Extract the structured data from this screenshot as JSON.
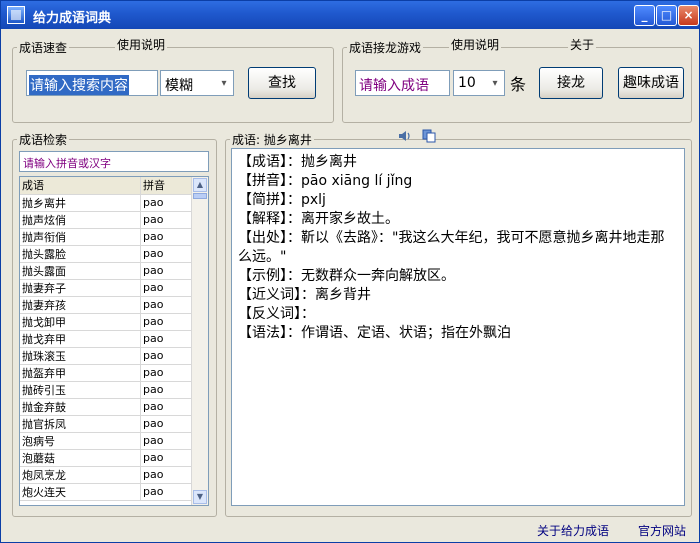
{
  "window": {
    "title": "给力成语词典"
  },
  "titlebar": {
    "minimize": "_",
    "maximize": "□",
    "close": "×"
  },
  "search": {
    "group_title": "成语速查",
    "help": "使用说明",
    "input_value": "请输入搜索内容",
    "mode": "模糊",
    "button": "查找"
  },
  "game": {
    "group_title": "成语接龙游戏",
    "help": "使用说明",
    "about": "关于",
    "input_value": "请输入成语",
    "count": "10",
    "unit": "条",
    "button": "接龙",
    "fun_button": "趣味成语"
  },
  "browse": {
    "group_title": "成语检索",
    "filter_placeholder": "请输入拼音或汉字",
    "columns": [
      "成语",
      "拼音"
    ],
    "rows": [
      [
        "抛乡离井",
        "pao"
      ],
      [
        "抛声炫俏",
        "pao"
      ],
      [
        "抛声衔俏",
        "pao"
      ],
      [
        "抛头露脸",
        "pao"
      ],
      [
        "抛头露面",
        "pao"
      ],
      [
        "抛妻弃子",
        "pao"
      ],
      [
        "抛妻弃孩",
        "pao"
      ],
      [
        "抛戈卸甲",
        "pao"
      ],
      [
        "抛戈弃甲",
        "pao"
      ],
      [
        "抛珠滚玉",
        "pao"
      ],
      [
        "抛盔弃甲",
        "pao"
      ],
      [
        "抛砖引玉",
        "pao"
      ],
      [
        "抛金弃鼓",
        "pao"
      ],
      [
        "抛官拆凤",
        "pao"
      ],
      [
        "泡病号",
        "pao"
      ],
      [
        "泡蘑菇",
        "pao"
      ],
      [
        "炮凤烹龙",
        "pao"
      ],
      [
        "炮火连天",
        "pao"
      ]
    ]
  },
  "detail": {
    "group_title": "成语: 抛乡离井",
    "lines": [
      "【成语】：抛乡离井",
      "【拼音】：pāo xiāng lí jǐng",
      "【简拼】：pxlj",
      "【解释】：离开家乡故土。",
      "【出处】：靳以《去路》：\"我这么大年纪，我可不愿意抛乡离井地走那么远。\"",
      "【示例】：无数群众一奔向解放区。",
      "【近义词】：离乡背井",
      "【反义词】：",
      "【语法】：作谓语、定语、状语；指在外飘泊"
    ]
  },
  "footer": {
    "about_link": "关于给力成语",
    "site_link": "官方网站"
  },
  "colors": {
    "title_bar": "#1f58cd",
    "input_text": "#800080",
    "link": "#000080"
  }
}
